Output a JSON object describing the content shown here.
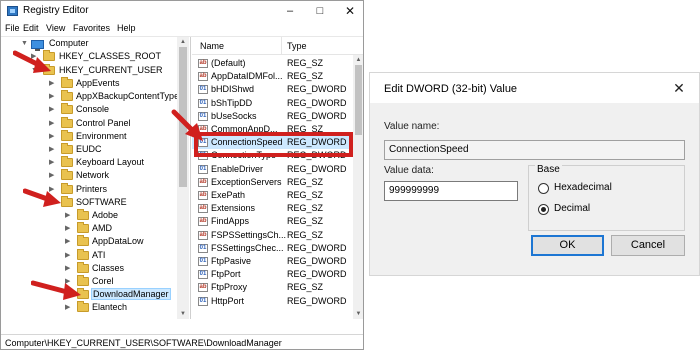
{
  "registry": {
    "title": "Registry Editor",
    "menu": [
      "File",
      "Edit",
      "View",
      "Favorites",
      "Help"
    ],
    "tree": {
      "root": "Computer",
      "hkcr": "HKEY_CLASSES_ROOT",
      "hkcu": "HKEY_CURRENT_USER",
      "hkcu_children": [
        "AppEvents",
        "AppXBackupContentType",
        "Console",
        "Control Panel",
        "Environment",
        "EUDC",
        "Keyboard Layout",
        "Network",
        "Printers",
        "SOFTWARE"
      ],
      "software_children": [
        "Adobe",
        "AMD",
        "AppDataLow",
        "ATI",
        "Classes",
        "Corel",
        "DownloadManager",
        "Elantech"
      ],
      "selected": "DownloadManager"
    },
    "columns": {
      "name": "Name",
      "type": "Type"
    },
    "values": [
      {
        "name": "(Default)",
        "type": "REG_SZ",
        "kind": "sz"
      },
      {
        "name": "AppDataIDMFol...",
        "type": "REG_SZ",
        "kind": "sz"
      },
      {
        "name": "bHDIShwd",
        "type": "REG_DWORD",
        "kind": "dword"
      },
      {
        "name": "bShTipDD",
        "type": "REG_DWORD",
        "kind": "dword"
      },
      {
        "name": "bUseSocks",
        "type": "REG_DWORD",
        "kind": "dword"
      },
      {
        "name": "CommonAppD...",
        "type": "REG_SZ",
        "kind": "sz"
      },
      {
        "name": "ConnectionSpeed",
        "type": "REG_DWORD",
        "kind": "dword"
      },
      {
        "name": "ConnectionType",
        "type": "REG_DWORD",
        "kind": "dword"
      },
      {
        "name": "EnableDriver",
        "type": "REG_DWORD",
        "kind": "dword"
      },
      {
        "name": "ExceptionServers",
        "type": "REG_SZ",
        "kind": "sz"
      },
      {
        "name": "ExePath",
        "type": "REG_SZ",
        "kind": "sz"
      },
      {
        "name": "Extensions",
        "type": "REG_SZ",
        "kind": "sz"
      },
      {
        "name": "FindApps",
        "type": "REG_SZ",
        "kind": "sz"
      },
      {
        "name": "FSPSSettingsCh...",
        "type": "REG_SZ",
        "kind": "sz"
      },
      {
        "name": "FSSettingsChec...",
        "type": "REG_DWORD",
        "kind": "dword"
      },
      {
        "name": "FtpPasive",
        "type": "REG_DWORD",
        "kind": "dword"
      },
      {
        "name": "FtpPort",
        "type": "REG_DWORD",
        "kind": "dword"
      },
      {
        "name": "FtpProxy",
        "type": "REG_SZ",
        "kind": "sz"
      },
      {
        "name": "HttpPort",
        "type": "REG_DWORD",
        "kind": "dword"
      }
    ],
    "highlighted_value": "ConnectionSpeed",
    "status_path": "Computer\\HKEY_CURRENT_USER\\SOFTWARE\\DownloadManager",
    "accent_color": "#d0201e"
  },
  "dialog": {
    "title": "Edit DWORD (32-bit) Value",
    "value_name_label": "Value name:",
    "value_name": "ConnectionSpeed",
    "value_data_label": "Value data:",
    "value_data": "999999999",
    "base_label": "Base",
    "hex_label": "Hexadecimal",
    "decimal_label": "Decimal",
    "base_selected": "Decimal",
    "ok_label": "OK",
    "cancel_label": "Cancel"
  }
}
